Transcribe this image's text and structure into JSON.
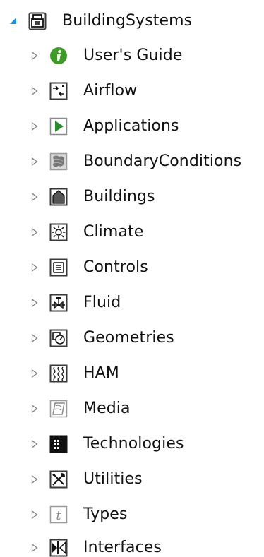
{
  "tree": {
    "root": {
      "label": "BuildingSystems",
      "icon": "package-icon",
      "expanded": true
    },
    "items": [
      {
        "label": "User's Guide",
        "icon": "info-icon"
      },
      {
        "label": "Airflow",
        "icon": "airflow-icon"
      },
      {
        "label": "Applications",
        "icon": "play-icon"
      },
      {
        "label": "BoundaryConditions",
        "icon": "boundary-conditions-icon"
      },
      {
        "label": "Buildings",
        "icon": "building-icon"
      },
      {
        "label": "Climate",
        "icon": "sun-icon"
      },
      {
        "label": "Controls",
        "icon": "controls-icon"
      },
      {
        "label": "Fluid",
        "icon": "valve-icon"
      },
      {
        "label": "Geometries",
        "icon": "geometry-icon"
      },
      {
        "label": "HAM",
        "icon": "ham-icon"
      },
      {
        "label": "Media",
        "icon": "media-icon"
      },
      {
        "label": "Technologies",
        "icon": "technologies-icon"
      },
      {
        "label": "Utilities",
        "icon": "utilities-icon"
      },
      {
        "label": "Types",
        "icon": "types-icon"
      },
      {
        "label": "Interfaces",
        "icon": "interfaces-icon"
      }
    ]
  },
  "colors": {
    "expander_open": "#1e90d8",
    "expander_closed": "#7a7a7a",
    "info_green": "#3f9a2a",
    "play_green": "#2e8b2e",
    "icon_border": "#3a3a3a"
  }
}
